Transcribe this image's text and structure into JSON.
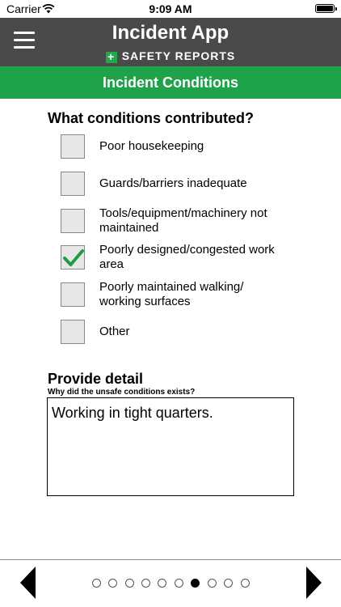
{
  "status_bar": {
    "carrier": "Carrier",
    "time": "9:09 AM"
  },
  "header": {
    "title": "Incident App",
    "brand": "SAFETY REPORTS",
    "brand_icon": "plus"
  },
  "section": {
    "title": "Incident Conditions"
  },
  "question": "What conditions contributed?",
  "options": [
    {
      "label": "Poor housekeeping",
      "checked": false
    },
    {
      "label": "Guards/barriers inadequate",
      "checked": false
    },
    {
      "label": "Tools/equipment/machinery not maintained",
      "checked": false
    },
    {
      "label": "Poorly designed/congested work area",
      "checked": true
    },
    {
      "label": "Poorly maintained walking/ working surfaces",
      "checked": false
    },
    {
      "label": "Other",
      "checked": false
    }
  ],
  "detail": {
    "title": "Provide detail",
    "subtitle": "Why did the unsafe conditions exists?",
    "value": "Working in tight quarters."
  },
  "pager": {
    "total": 10,
    "current": 7
  },
  "colors": {
    "header": "#4a4a4a",
    "accent_green": "#1ea24a",
    "check_green": "#1e9a48"
  }
}
